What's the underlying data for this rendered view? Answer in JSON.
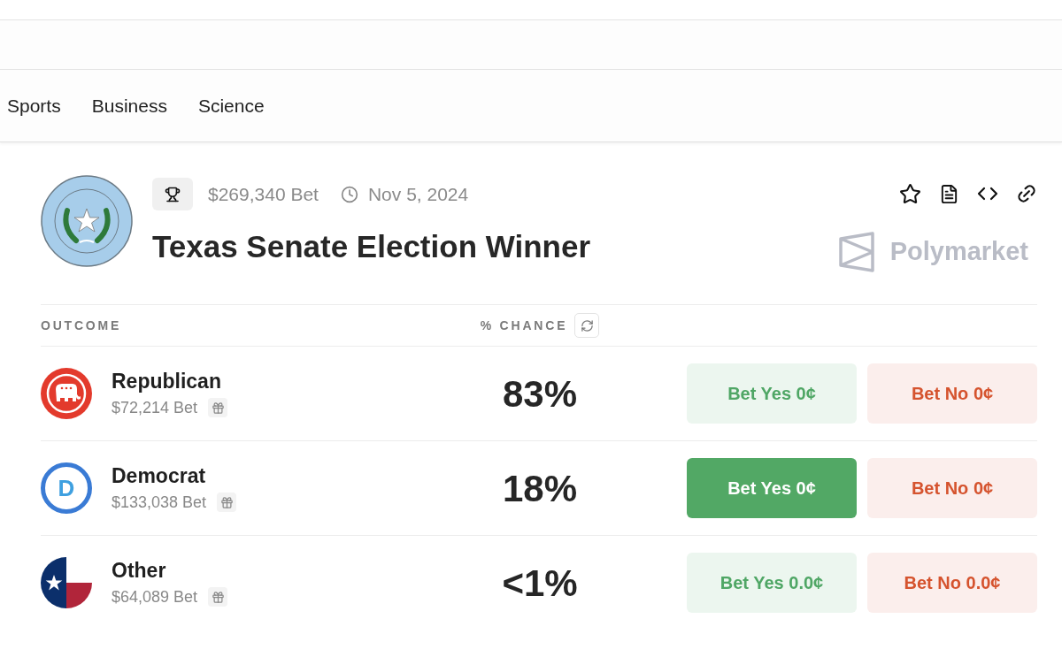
{
  "nav": {
    "items": [
      {
        "label": "Sports"
      },
      {
        "label": "Business"
      },
      {
        "label": "Science"
      }
    ]
  },
  "market": {
    "volume": "$269,340 Bet",
    "end_date": "Nov 5, 2024",
    "title": "Texas Senate Election Winner",
    "brand": "Polymarket"
  },
  "table": {
    "columns": [
      {
        "label": "OUTCOME"
      },
      {
        "label": "% CHANCE"
      }
    ],
    "rows": [
      {
        "kind": "republican",
        "name": "Republican",
        "volume": "$72,214 Bet",
        "chance": "83%",
        "buttons": [
          {
            "kind": "yes",
            "label": "Bet Yes 0¢",
            "selected": false
          },
          {
            "kind": "no",
            "label": "Bet No 0¢",
            "selected": false
          }
        ]
      },
      {
        "kind": "democrat",
        "logo_text": "D",
        "name": "Democrat",
        "volume": "$133,038 Bet",
        "chance": "18%",
        "buttons": [
          {
            "kind": "yes",
            "label": "Bet Yes 0¢",
            "selected": true
          },
          {
            "kind": "no",
            "label": "Bet No 0¢",
            "selected": false
          }
        ]
      },
      {
        "kind": "texas",
        "name": "Other",
        "volume": "$64,089 Bet",
        "chance": "<1%",
        "buttons": [
          {
            "kind": "yes",
            "label": "Bet Yes 0.0¢",
            "selected": false
          },
          {
            "kind": "no",
            "label": "Bet No 0.0¢",
            "selected": false
          }
        ]
      }
    ]
  }
}
